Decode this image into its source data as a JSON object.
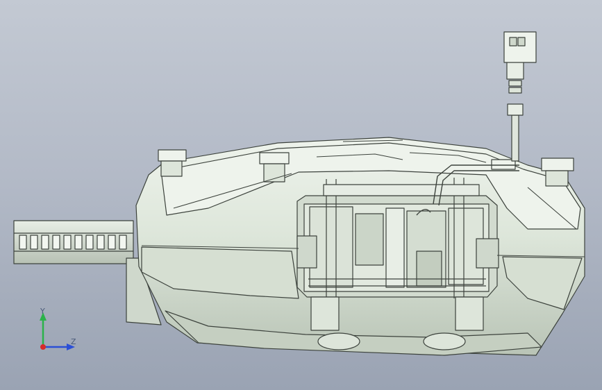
{
  "viewport": {
    "name": "3d-model-viewport",
    "background_top": "#c3c9d3",
    "background_bottom": "#9aa3b3",
    "model_fill": "#e4ebe2",
    "model_edge": "#3c423c"
  },
  "triad": {
    "y_label": "Y",
    "z_label": "Z",
    "y_color": "#2bb24a",
    "z_color": "#2b4fd6",
    "x_color": "#d62b2b"
  }
}
